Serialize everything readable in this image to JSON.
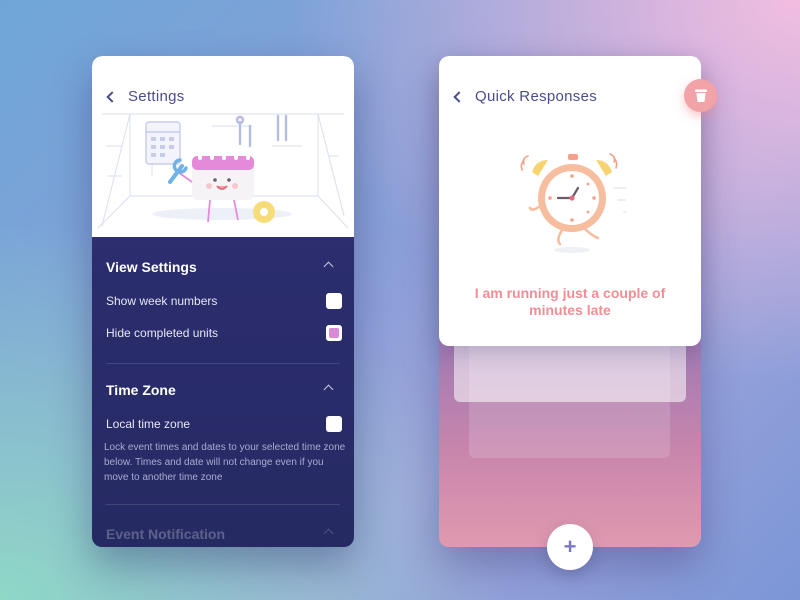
{
  "settings_panel": {
    "title": "Settings",
    "sections": [
      {
        "title": "View Settings",
        "options": [
          {
            "label": "Show week numbers",
            "checked": false
          },
          {
            "label": "Hide completed units",
            "checked": true
          }
        ]
      },
      {
        "title": "Time Zone",
        "options": [
          {
            "label": "Local time zone",
            "checked": false
          }
        ],
        "description": "Lock event times and dates to your selected time zone below. Times and date will not change even if you move to another time zone"
      },
      {
        "title": "Event Notification"
      }
    ]
  },
  "quick_responses_panel": {
    "title": "Quick Responses",
    "message": "I am running just a couple of minutes late",
    "add_label": "+"
  },
  "icons": {
    "back": "chevron-left-icon",
    "collapse": "chevron-up-icon",
    "delete": "trash-icon",
    "add": "plus-icon"
  },
  "colors": {
    "accent_pink": "#f08e96",
    "checkbox_checked": "#d98bd8",
    "panel_dark": "#2b2d6e",
    "title_text": "#4a4d8c"
  }
}
